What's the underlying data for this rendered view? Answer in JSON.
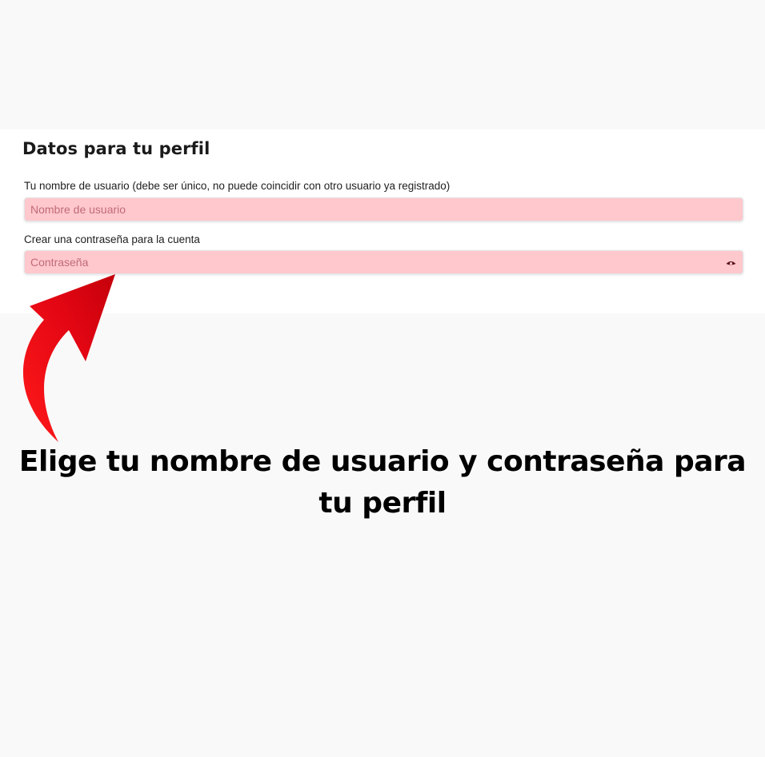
{
  "profile": {
    "title": "Datos para tu perfil"
  },
  "username": {
    "label": "Tu nombre de usuario (debe ser único, no puede coincidir con otro usuario ya registrado)",
    "placeholder": "Nombre de usuario",
    "value": ""
  },
  "password": {
    "label": "Crear una contraseña para la cuenta",
    "placeholder": "Contraseña",
    "value": "",
    "toggle_icon": "eye-icon"
  },
  "annotation": {
    "caption": "Elige tu nombre de usuario y contraseña para tu perfil",
    "arrow_icon": "curved-arrow-icon"
  },
  "colors": {
    "field_background": "#ffc8cd",
    "placeholder": "#c06b76",
    "arrow": "#e30613",
    "eye_icon": "#5a1018"
  }
}
